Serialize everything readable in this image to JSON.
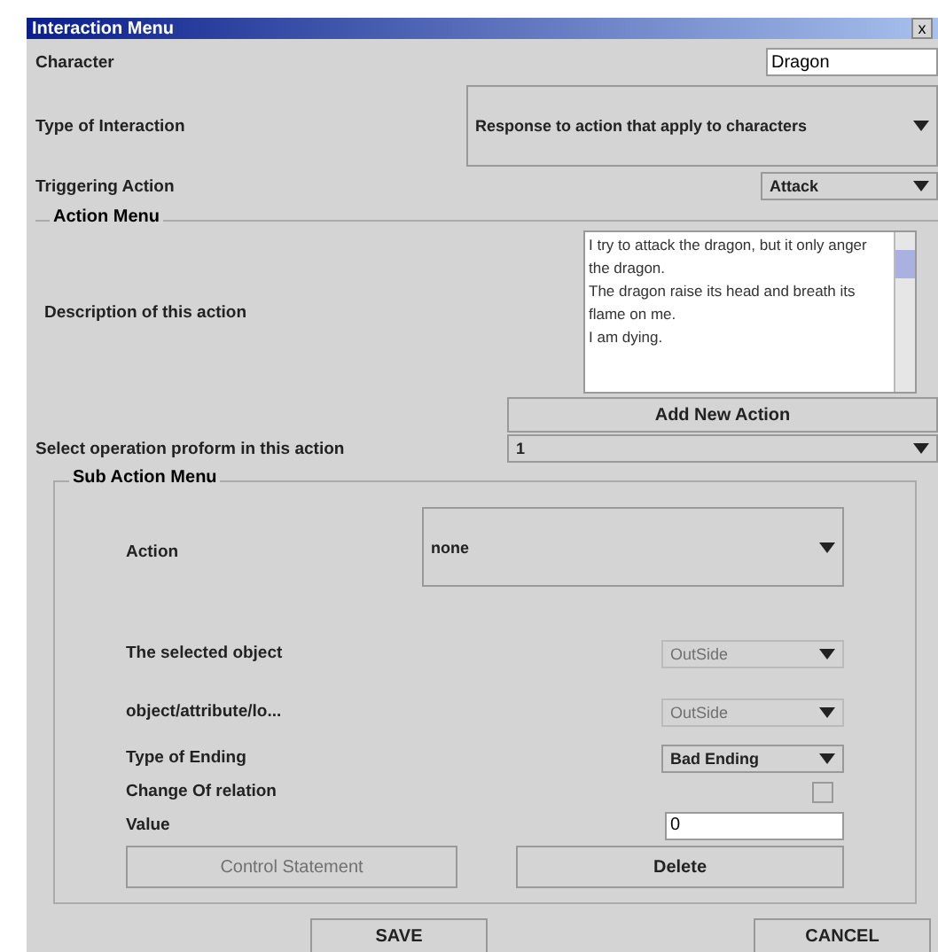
{
  "window": {
    "title": "Interaction Menu",
    "close": "x"
  },
  "character": {
    "label": "Character",
    "value": "Dragon"
  },
  "interaction_type": {
    "label": "Type of Interaction",
    "value": "Response to action that apply to characters"
  },
  "triggering_action": {
    "label": "Triggering Action",
    "value": "Attack"
  },
  "action_menu": {
    "title": "Action Menu",
    "description": {
      "label": "Description of this action",
      "value": "I try to attack the dragon, but it only anger the dragon.\nThe dragon raise its head and breath its flame on me.\nI am dying."
    },
    "add_button": "Add New Action",
    "operation": {
      "label": "Select operation proform in this action",
      "value": "1"
    }
  },
  "sub_action_menu": {
    "title": "Sub Action Menu",
    "rows": [
      {
        "kind": "big_dropdown",
        "label": "Action",
        "value": "none"
      },
      {
        "kind": "dropdown",
        "label": "The selected object",
        "value": "OutSide",
        "disabled": true
      },
      {
        "kind": "dropdown",
        "label": "object/attribute/lo...",
        "value": "OutSide",
        "disabled": true
      },
      {
        "kind": "dropdown",
        "label": "Type of Ending",
        "value": "Bad Ending",
        "disabled": false
      },
      {
        "kind": "checkbox",
        "label": "Change Of relation",
        "checked": false
      },
      {
        "kind": "text",
        "label": "Value",
        "value": "0"
      }
    ],
    "buttons": [
      {
        "label": "Control Statement",
        "disabled": true
      },
      {
        "label": "Delete",
        "disabled": false
      }
    ]
  },
  "buttons": [
    "SAVE",
    "CANCEL"
  ]
}
